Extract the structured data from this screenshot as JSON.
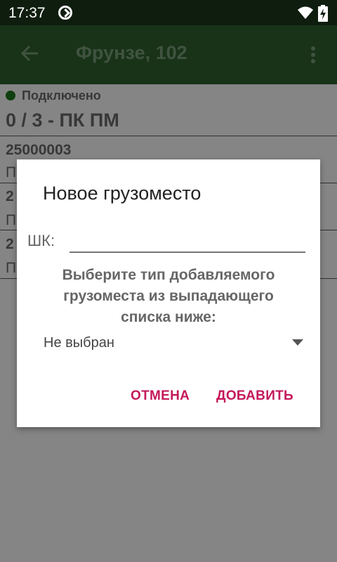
{
  "status_bar": {
    "time": "17:37"
  },
  "app_bar": {
    "title": "Фрунзе, 102"
  },
  "connection": {
    "status": "Подключено"
  },
  "counter": "0 / 3 - ПК ПМ",
  "list": [
    {
      "code": "25000003",
      "sub": "П"
    },
    {
      "code": "2",
      "sub": "П"
    },
    {
      "code": "2",
      "sub": "П"
    }
  ],
  "dialog": {
    "title": "Новое грузоместо",
    "barcode_label": "ШК:",
    "barcode_value": "",
    "prompt": "Выберите тип добавляемого грузоместа из выпадающего списка ниже:",
    "select_value": "Не выбран",
    "cancel": "ОТМЕНА",
    "add": "ДОБАВИТЬ"
  },
  "icons": {
    "back": "arrow-back-icon",
    "menu": "more-vert-icon",
    "sync": "sync-status-icon",
    "wifi": "wifi-icon",
    "battery": "battery-charging-icon",
    "dropdown": "dropdown-arrow-icon"
  },
  "colors": {
    "app_bar": "#2f622f",
    "connected": "#1e7a1e",
    "button_text": "#c4185a"
  }
}
